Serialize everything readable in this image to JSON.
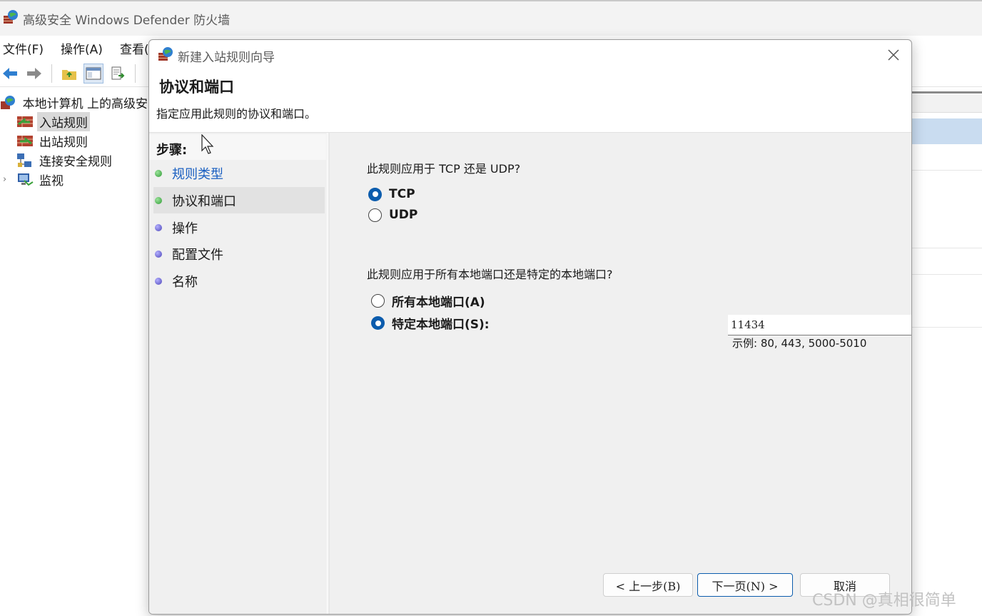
{
  "main_window": {
    "title": "高级安全 Windows Defender 防火墙",
    "menu": [
      "文件(F)",
      "操作(A)",
      "查看("
    ],
    "tree": {
      "root": "本地计算机 上的高级安",
      "items": [
        {
          "label": "入站规则",
          "selected": true
        },
        {
          "label": "出站规则",
          "selected": false
        },
        {
          "label": "连接安全规则",
          "selected": false
        },
        {
          "label": "监视",
          "selected": false,
          "expandable": true
        }
      ]
    }
  },
  "dialog": {
    "title": "新建入站规则向导",
    "heading": "协议和端口",
    "subheading": "指定应用此规则的协议和端口。",
    "steps_header": "步骤:",
    "steps": [
      {
        "label": "规则类型",
        "status": "done"
      },
      {
        "label": "协议和端口",
        "status": "current"
      },
      {
        "label": "操作",
        "status": "pending"
      },
      {
        "label": "配置文件",
        "status": "pending"
      },
      {
        "label": "名称",
        "status": "pending"
      }
    ],
    "protocol_question": "此规则应用于 TCP 还是 UDP?",
    "protocol_options": [
      {
        "label": "TCP",
        "selected": true
      },
      {
        "label": "UDP",
        "selected": false
      }
    ],
    "port_question": "此规则应用于所有本地端口还是特定的本地端口?",
    "port_options": [
      {
        "label": "所有本地端口(A)",
        "selected": false
      },
      {
        "label": "特定本地端口(S):",
        "selected": true
      }
    ],
    "port_value": "11434",
    "port_example": "示例: 80, 443, 5000-5010",
    "buttons": {
      "back": "< 上一步(B)",
      "next": "下一页(N) >",
      "cancel": "取消"
    }
  },
  "watermark": "CSDN @真相很简单",
  "colors": {
    "accent": "#0b5cad",
    "link": "#1a5fc1",
    "step_done": "#2f9a34",
    "step_pending": "#4c45b8"
  }
}
